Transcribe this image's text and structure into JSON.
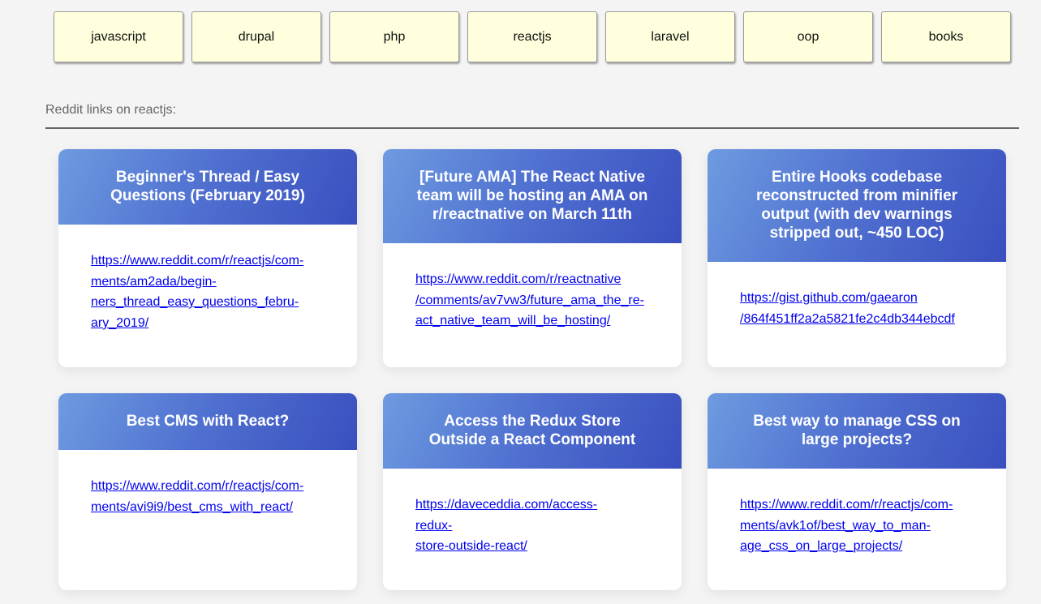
{
  "topics": [
    "javascript",
    "drupal",
    "php",
    "reactjs",
    "laravel",
    "oop",
    "books"
  ],
  "section": {
    "title": "Reddit links on reactjs:"
  },
  "cards": [
    {
      "title": "Beginner's Thread / Easy Questions (February 2019)",
      "link_lines": [
        "https://www.reddit.com/r/reactjs/com-",
        "ments/am2ada/begin-",
        "ners_thread_easy_questions_febru-",
        "ary_2019/"
      ]
    },
    {
      "title": "[Future AMA] The React Native team will be hosting an AMA on r/reactnative on March 11th",
      "link_lines": [
        "https://www.reddit.com/r/reactnative",
        "/comments/av7vw3/future_ama_the_re-",
        "act_native_team_will_be_hosting/"
      ]
    },
    {
      "title": "Entire Hooks codebase reconstructed from minifier output (with dev warnings stripped out, ~450 LOC)",
      "link_lines": [
        "https://gist.github.com/gaearon",
        "/864f451ff2a2a5821fe2c4db344ebcdf"
      ]
    },
    {
      "title": "Best CMS with React?",
      "link_lines": [
        "https://www.reddit.com/r/reactjs/com-",
        "ments/avi9i9/best_cms_with_react/"
      ]
    },
    {
      "title": "Access the Redux Store Outside a React Component",
      "link_lines": [
        "https://daveceddia.com/access-redux-",
        "store-outside-react/"
      ]
    },
    {
      "title": "Best way to manage CSS on large projects?",
      "link_lines": [
        "https://www.reddit.com/r/reactjs/com-",
        "ments/avk1of/best_way_to_man-",
        "age_css_on_large_projects/"
      ]
    }
  ]
}
